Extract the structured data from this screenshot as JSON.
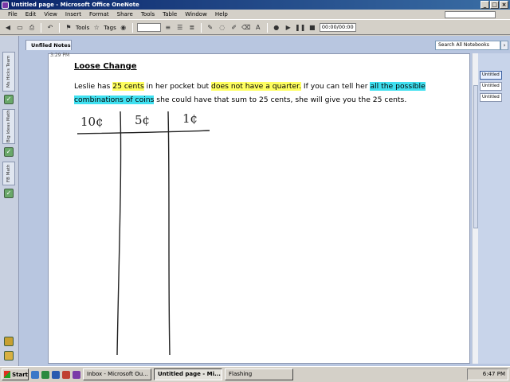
{
  "window": {
    "title": "Untitled page - Microsoft Office OneNote"
  },
  "menu": {
    "items": [
      "File",
      "Edit",
      "View",
      "Insert",
      "Format",
      "Share",
      "Tools",
      "Table",
      "Window",
      "Help"
    ]
  },
  "toolbar": {
    "tools_label": "Tools",
    "tags_label": "Tags",
    "time": "00:00/00:00"
  },
  "notebook": {
    "section_tab": "Unfiled Notes",
    "search_placeholder": "Search All Notebooks"
  },
  "left_tabs": [
    "Ms Hicks Team",
    "Big Ideas Math",
    "FB Math"
  ],
  "page": {
    "time": "3:29 PM",
    "title": "Loose Change",
    "body": {
      "p1": "Leslie has ",
      "h1": "25 cents",
      "p2": " in her pocket but ",
      "h2": "does not have a quarter.",
      "p3": " If you can tell her ",
      "h3": "all the possible combinations of coins",
      "p4": " she could have that sum to 25 cents, she will give you the 25 cents."
    },
    "handwriting": {
      "col1": "10¢",
      "col2": "5¢",
      "col3": "1¢"
    }
  },
  "page_tabs": [
    "Untitled",
    "Untitled",
    "Untitled"
  ],
  "taskbar": {
    "start": "Start",
    "tasks": [
      "Inbox - Microsoft Ou...",
      "Untitled page - Mi...",
      "Flashing"
    ],
    "clock": "6:47 PM"
  },
  "colors": {
    "highlight_yellow": "#ffff60",
    "highlight_cyan": "#40e0f0"
  }
}
